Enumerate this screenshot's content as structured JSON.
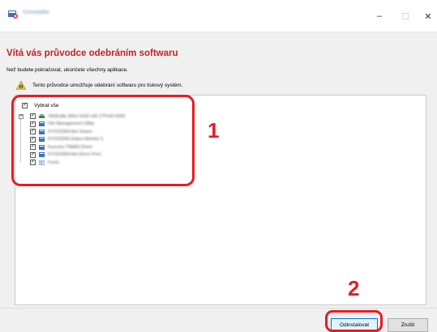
{
  "window": {
    "title": "Uninstaller",
    "controls": {
      "minimize": "–",
      "maximize": "☐",
      "close": "✕"
    }
  },
  "page": {
    "heading": "Vítá vás průvodce odebráním softwaru",
    "instruction": "Než budete pokračovat, ukončete všechny aplikace.",
    "info_icon": "warning-info-icon",
    "info_text": "Tento průvodce umožňuje odebrání softwaru pro tiskový systém."
  },
  "tree": {
    "select_all": {
      "label": "Vybrat vše",
      "checked": true
    },
    "items": [
      {
        "label": "TASKalfa 300ci 6x00 x00 27Px00 6000",
        "checked": true,
        "expandable": true
      },
      {
        "label": "File Management Utility",
        "checked": true
      },
      {
        "label": "KYOCERA Net Viewer",
        "checked": true
      },
      {
        "label": "KYOCERA Status Monitor 5",
        "checked": true
      },
      {
        "label": "Kyocera TWAIN Driver",
        "checked": true
      },
      {
        "label": "KYOCERA Net Direct Print",
        "checked": true
      },
      {
        "label": "Fonts",
        "checked": true
      }
    ]
  },
  "annotations": {
    "callout_1": "1",
    "callout_2": "2",
    "color": "#e81b23"
  },
  "buttons": {
    "uninstall": "Odinstalovat",
    "cancel": "Zrušit"
  }
}
